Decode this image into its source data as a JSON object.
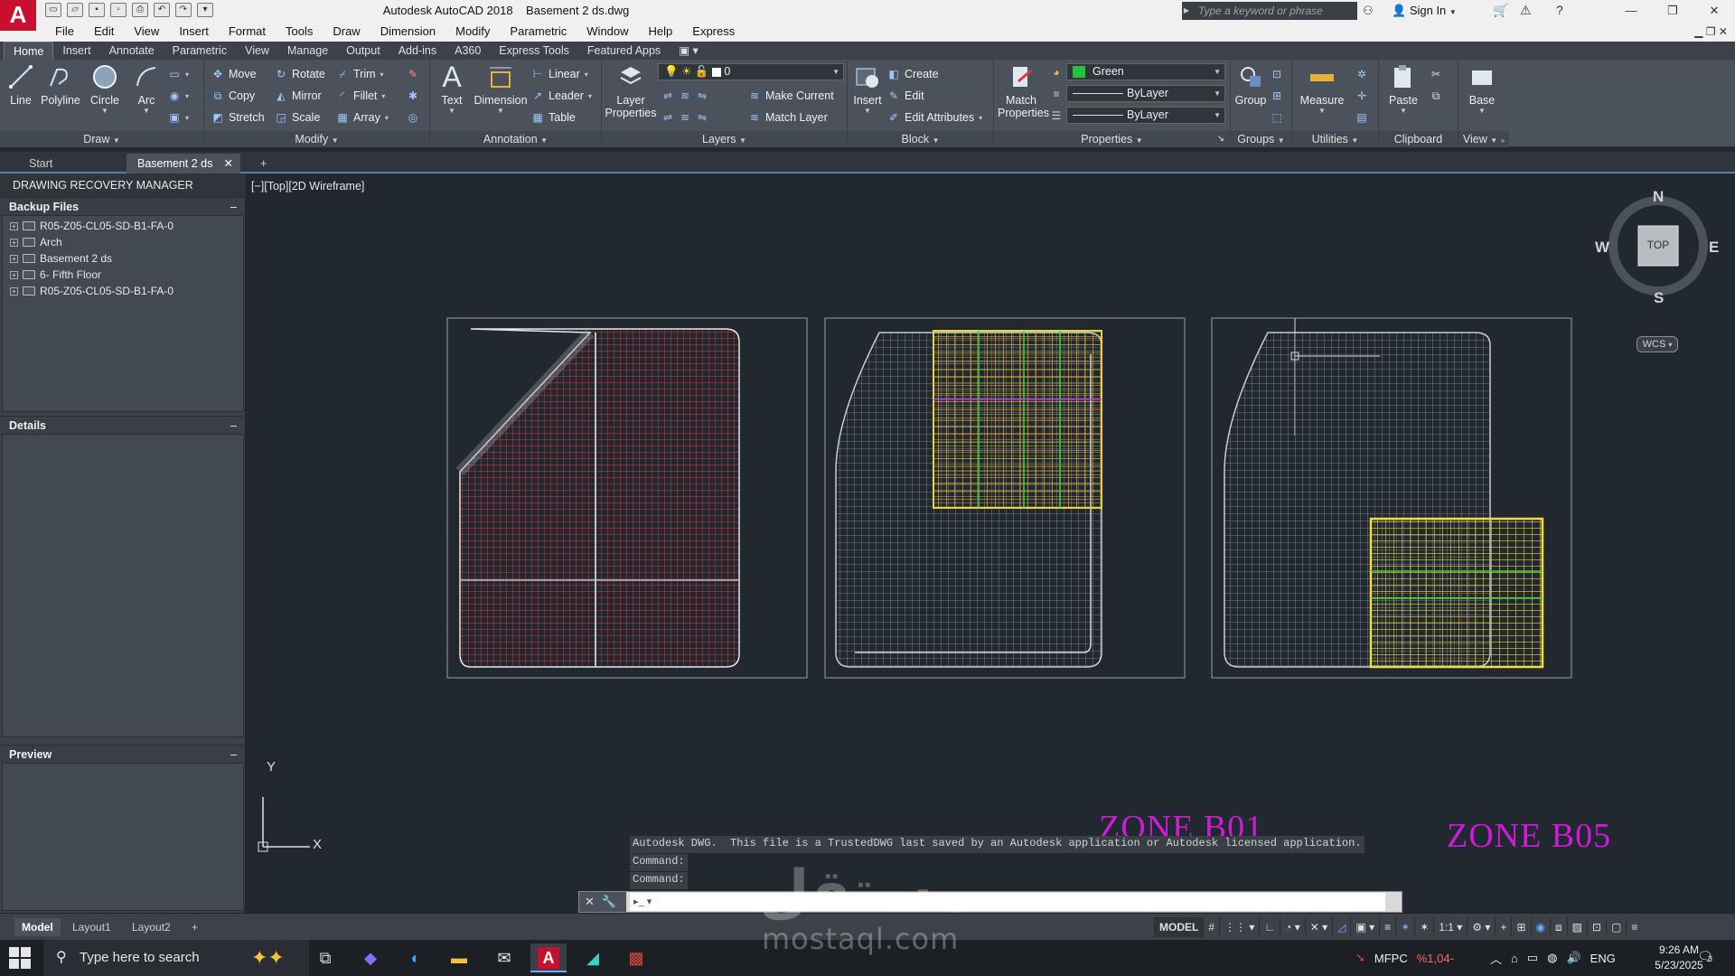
{
  "titlebar": {
    "app_title": "Autodesk AutoCAD 2018",
    "file_title": "Basement 2 ds.dwg",
    "search_placeholder": "Type a keyword or phrase",
    "sign_in": "Sign In",
    "logo_letter": "A"
  },
  "menu": [
    "File",
    "Edit",
    "View",
    "Insert",
    "Format",
    "Tools",
    "Draw",
    "Dimension",
    "Modify",
    "Parametric",
    "Window",
    "Help",
    "Express"
  ],
  "ribbon_tabs": [
    "Home",
    "Insert",
    "Annotate",
    "Parametric",
    "View",
    "Manage",
    "Output",
    "Add-ins",
    "A360",
    "Express Tools",
    "Featured Apps"
  ],
  "ribbon": {
    "draw": {
      "title": "Draw",
      "line": "Line",
      "polyline": "Polyline",
      "circle": "Circle",
      "arc": "Arc"
    },
    "modify": {
      "title": "Modify",
      "move": "Move",
      "rotate": "Rotate",
      "trim": "Trim",
      "copy": "Copy",
      "mirror": "Mirror",
      "fillet": "Fillet",
      "stretch": "Stretch",
      "scale": "Scale",
      "array": "Array"
    },
    "annotation": {
      "title": "Annotation",
      "text": "Text",
      "dimension": "Dimension",
      "linear": "Linear",
      "leader": "Leader",
      "table": "Table"
    },
    "layers": {
      "title": "Layers",
      "layer_properties_1": "Layer",
      "layer_properties_2": "Properties",
      "current_layer": "0",
      "make_current": "Make Current",
      "match_layer": "Match Layer"
    },
    "block": {
      "title": "Block",
      "insert": "Insert",
      "create": "Create",
      "edit": "Edit",
      "edit_attributes": "Edit Attributes"
    },
    "properties": {
      "title": "Properties",
      "match_1": "Match",
      "match_2": "Properties",
      "color": "Green",
      "color_hex": "#22c33a",
      "linetype": "ByLayer",
      "lineweight": "ByLayer"
    },
    "groups": {
      "title": "Groups",
      "group": "Group"
    },
    "utilities": {
      "title": "Utilities",
      "measure": "Measure"
    },
    "clipboard": {
      "title": "Clipboard",
      "paste": "Paste"
    },
    "view": {
      "title": "View",
      "base": "Base"
    }
  },
  "file_tabs": [
    "Start",
    "Basement 2 ds"
  ],
  "drm": {
    "title": "DRAWING RECOVERY MANAGER",
    "backup_files": "Backup Files",
    "files": [
      "R05-Z05-CL05-SD-B1-FA-0",
      "Arch",
      "Basement 2 ds",
      "6- Fifth Floor",
      "R05-Z05-CL05-SD-B1-FA-0"
    ],
    "details": "Details",
    "preview": "Preview"
  },
  "viewport": {
    "label": "[−][Top][2D Wireframe]",
    "viewcube": {
      "n": "N",
      "s": "S",
      "e": "E",
      "w": "W",
      "top": "TOP",
      "wcs": "WCS"
    },
    "ucs": {
      "x": "X",
      "y": "Y"
    },
    "zones": [
      "ZONE B01",
      "ZONE B05"
    ]
  },
  "command": {
    "history": [
      "Autodesk DWG.  This file is a TrustedDWG last saved by an Autodesk application or Autodesk licensed application.",
      "Command:",
      "Command:"
    ],
    "input_value": ""
  },
  "layout_tabs": [
    "Model",
    "Layout1",
    "Layout2"
  ],
  "status": {
    "model": "MODEL",
    "scale": "1:1"
  },
  "taskbar": {
    "search_placeholder": "Type here to search",
    "ticker": "MFPC",
    "ticker_change": "%1,04-",
    "lang": "ENG",
    "time": "9:26 AM",
    "date": "5/23/2025",
    "notif_count": "3"
  },
  "watermark": {
    "arabic": "مستقل",
    "latin": "mostaql.com"
  }
}
